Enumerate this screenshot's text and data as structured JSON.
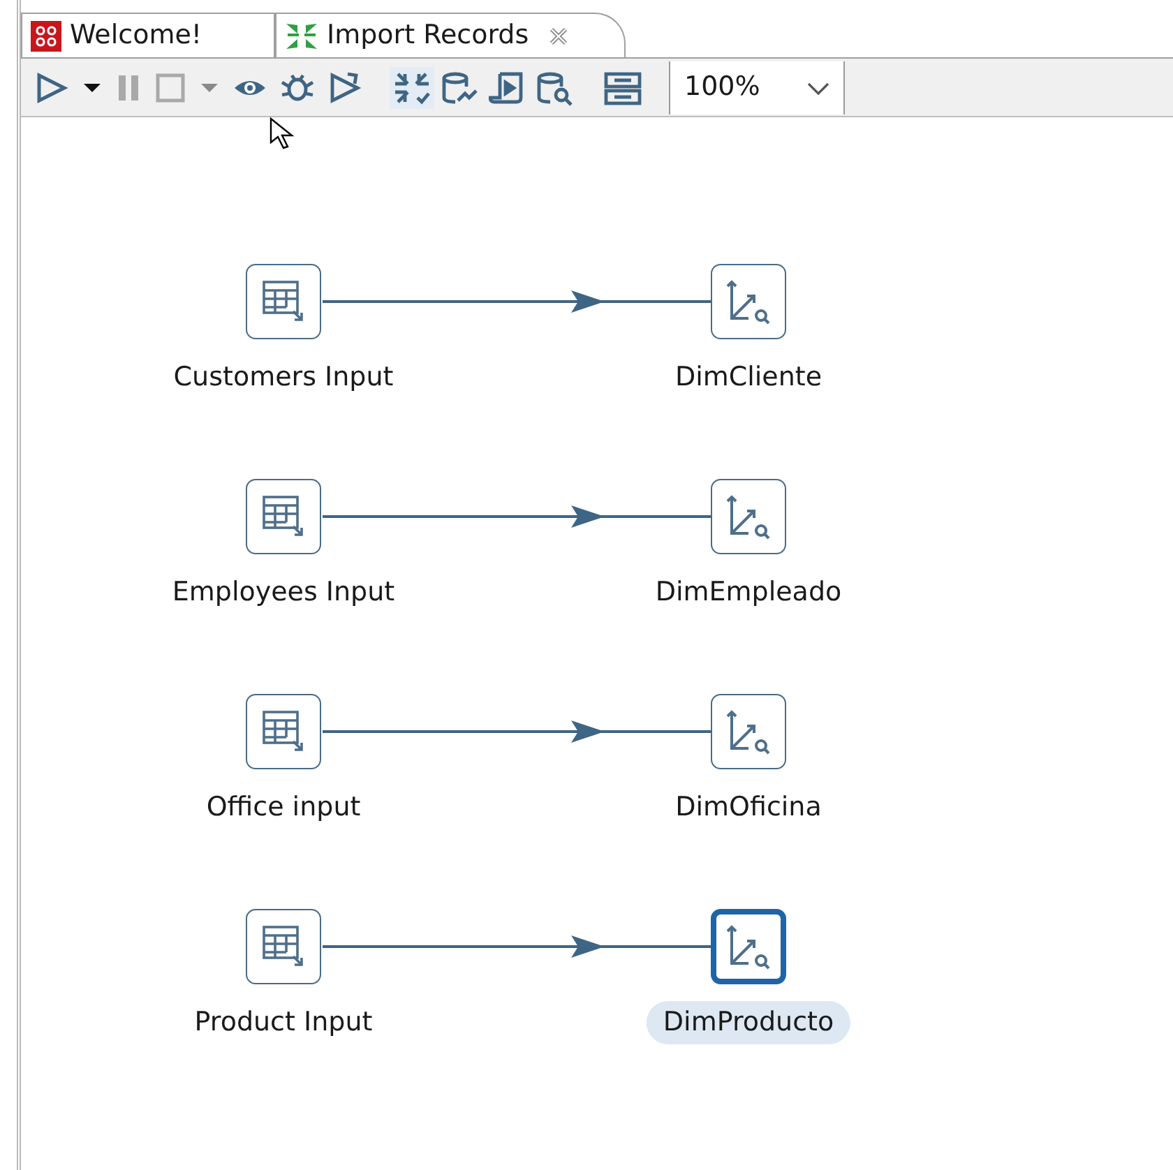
{
  "tabs": [
    {
      "label": "Welcome!",
      "selected": false,
      "kind": "welcome",
      "closable": false
    },
    {
      "label": "Import Records",
      "selected": true,
      "kind": "transform",
      "closable": true
    }
  ],
  "toolbar": {
    "zoom": "100%"
  },
  "hops": [
    {
      "from": {
        "label": "Customers Input",
        "selected": false
      },
      "to": {
        "label": "DimCliente",
        "selected": false
      }
    },
    {
      "from": {
        "label": "Employees Input",
        "selected": false
      },
      "to": {
        "label": "DimEmpleado",
        "selected": false
      }
    },
    {
      "from": {
        "label": "Office input",
        "selected": false
      },
      "to": {
        "label": "DimOficina",
        "selected": false
      }
    },
    {
      "from": {
        "label": "Product Input",
        "selected": false
      },
      "to": {
        "label": "DimProducto",
        "selected": true
      }
    }
  ]
}
